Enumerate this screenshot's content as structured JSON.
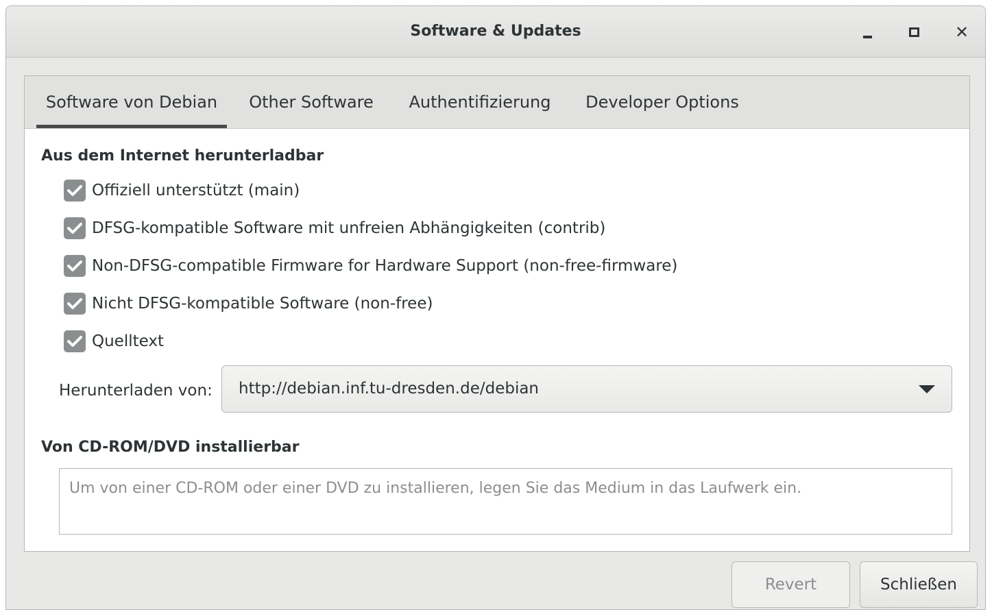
{
  "window": {
    "title": "Software & Updates"
  },
  "tabs": [
    {
      "label": "Software von Debian",
      "active": true
    },
    {
      "label": "Other Software",
      "active": false
    },
    {
      "label": "Authentifizierung",
      "active": false
    },
    {
      "label": "Developer Options",
      "active": false
    }
  ],
  "internet_section": {
    "heading": "Aus dem Internet herunterladbar",
    "options": [
      {
        "label": "Offiziell unterstützt (main)",
        "checked": true
      },
      {
        "label": "DFSG-kompatible Software mit unfreien Abhängigkeiten (contrib)",
        "checked": true
      },
      {
        "label": "Non-DFSG-compatible Firmware for Hardware Support (non-free-firmware)",
        "checked": true
      },
      {
        "label": "Nicht DFSG-kompatible Software (non-free)",
        "checked": true
      },
      {
        "label": "Quelltext",
        "checked": true
      }
    ],
    "download_label": "Herunterladen von:",
    "download_server": "http://debian.inf.tu-dresden.de/debian"
  },
  "cdrom_section": {
    "heading": "Von CD-ROM/DVD installierbar",
    "hint": "Um von einer CD-ROM oder einer DVD zu installieren, legen Sie das Medium in das Laufwerk ein."
  },
  "buttons": {
    "revert": "Revert",
    "close": "Schließen"
  },
  "icons": {
    "minimize": "minimize-icon",
    "maximize": "maximize-icon",
    "close": "close-icon",
    "checkbox": "checkmark-icon",
    "dropdown": "chevron-down-icon"
  }
}
